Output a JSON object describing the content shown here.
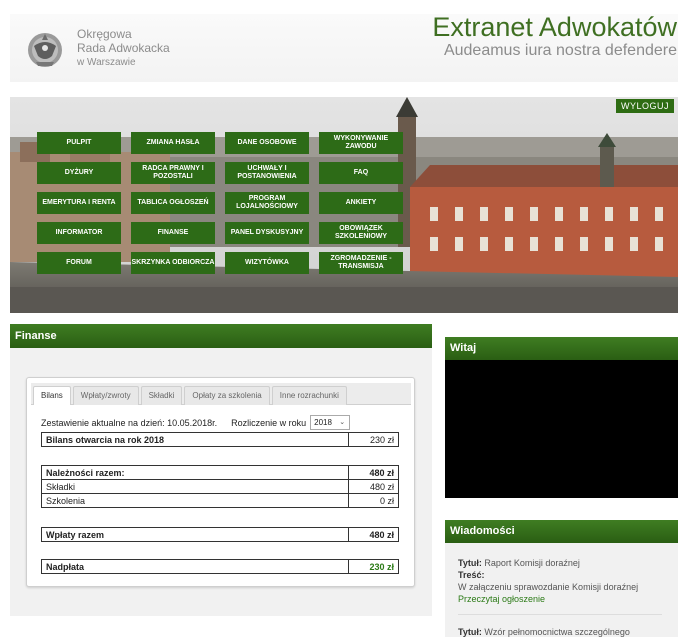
{
  "header": {
    "org_line1": "Okręgowa",
    "org_line2": "Rada Adwokacka",
    "org_line3": "w Warszawie",
    "title": "Extranet Adwokatów",
    "motto": "Audeamus iura nostra defendere"
  },
  "banner": {
    "logout_label": "WYLOGUJ",
    "menu": [
      "PULPIT",
      "ZMIANA HASŁA",
      "DANE OSOBOWE",
      "WYKONYWANIE ZAWODU",
      "DYŻURY",
      "RADCA PRAWNY I POZOSTALI",
      "UCHWAŁY I POSTANOWIENIA",
      "FAQ",
      "EMERYTURA I RENTA",
      "TABLICA OGŁOSZEŃ",
      "PROGRAM LOJALNOŚCIOWY",
      "ANKIETY",
      "INFORMATOR",
      "FINANSE",
      "PANEL DYSKUSYJNY",
      "OBOWIĄZEK SZKOLENIOWY",
      "FORUM",
      "SKRZYNKA ODBIORCZA",
      "WIZYTÓWKA",
      "ZGROMADZENIE - TRANSMISJA"
    ]
  },
  "finanse": {
    "panel_title": "Finanse",
    "tabs": [
      "Bilans",
      "Wpłaty/zwroty",
      "Składki",
      "Opłaty za szkolenia",
      "Inne rozrachunki"
    ],
    "status_label": "Zestawienie aktualne na dzień: 10.05.2018r.",
    "year_label": "Rozliczenie w roku",
    "year_value": "2018",
    "bilans_label": "Bilans otwarcia na rok 2018",
    "bilans_value": "230 zł",
    "naleznosci_label": "Należności razem:",
    "naleznosci_value": "480 zł",
    "skladki_label": "Składki",
    "skladki_value": "480 zł",
    "szkolenia_label": "Szkolenia",
    "szkolenia_value": "0 zł",
    "wplaty_label": "Wpłaty razem",
    "wplaty_value": "480 zł",
    "nadplata_label": "Nadpłata",
    "nadplata_value": "230 zł"
  },
  "witaj": {
    "panel_title": "Witaj"
  },
  "wiadomosci": {
    "panel_title": "Wiadomości",
    "msg1_title_label": "Tytuł:",
    "msg1_title": "Raport Komisji doraźnej",
    "msg1_body_label": "Treść:",
    "msg1_body": "W załączeniu sprawozdanie Komisji doraźnej",
    "msg1_link": "Przeczytaj ogłoszenie",
    "msg2_title_label": "Tytuł:",
    "msg2_title": "Wzór pełnomocnictwa szczególnego"
  },
  "colors": {
    "brand_green": "#3f6f22",
    "menu_green": "#2d6b17",
    "accent_green": "#2b7a16"
  }
}
